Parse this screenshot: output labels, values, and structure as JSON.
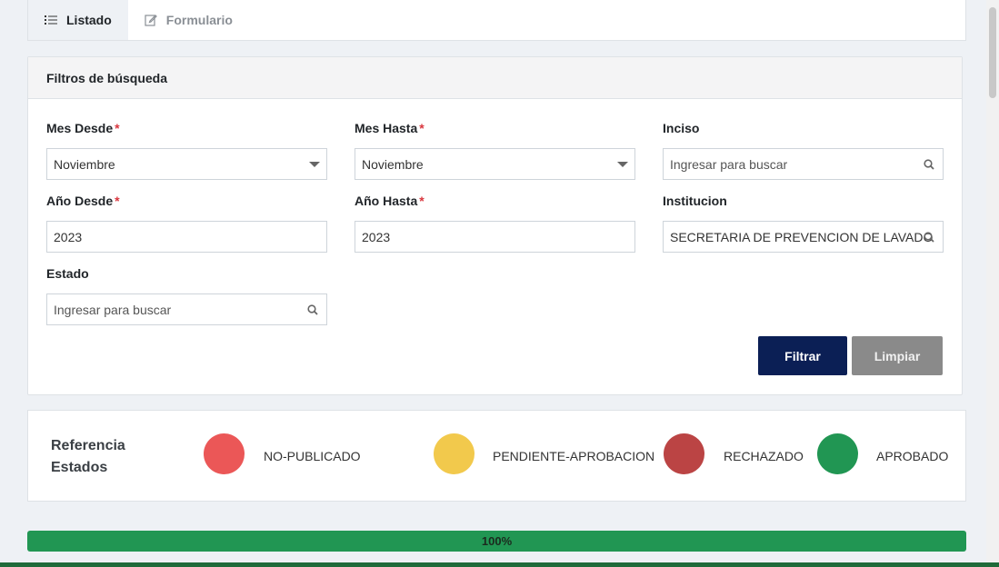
{
  "tabs": [
    {
      "label": "Listado",
      "icon": "list-icon",
      "active": true
    },
    {
      "label": "Formulario",
      "icon": "edit-icon",
      "active": false
    }
  ],
  "filters": {
    "title": "Filtros de búsqueda",
    "required_mark": "*",
    "mes_desde": {
      "label": "Mes Desde",
      "value": "Noviembre"
    },
    "mes_hasta": {
      "label": "Mes Hasta",
      "value": "Noviembre"
    },
    "inciso": {
      "label": "Inciso",
      "placeholder": "Ingresar para buscar"
    },
    "anio_desde": {
      "label": "Año Desde",
      "value": "2023"
    },
    "anio_hasta": {
      "label": "Año Hasta",
      "value": "2023"
    },
    "institucion": {
      "label": "Institucion",
      "value": "SECRETARIA DE PREVENCION DE LAVADO DE"
    },
    "estado": {
      "label": "Estado",
      "placeholder": "Ingresar para buscar"
    },
    "filtrar_label": "Filtrar",
    "limpiar_label": "Limpiar"
  },
  "legend": {
    "title": "Referencia Estados",
    "items": [
      {
        "label": "NO-PUBLICADO",
        "color": "#eb5757"
      },
      {
        "label": "PENDIENTE-APROBACION",
        "color": "#f2c94c"
      },
      {
        "label": "RECHAZADO",
        "color": "#bb4444"
      },
      {
        "label": "APROBADO",
        "color": "#219653"
      }
    ]
  },
  "progress": {
    "label": "100%",
    "value": 1.0
  }
}
